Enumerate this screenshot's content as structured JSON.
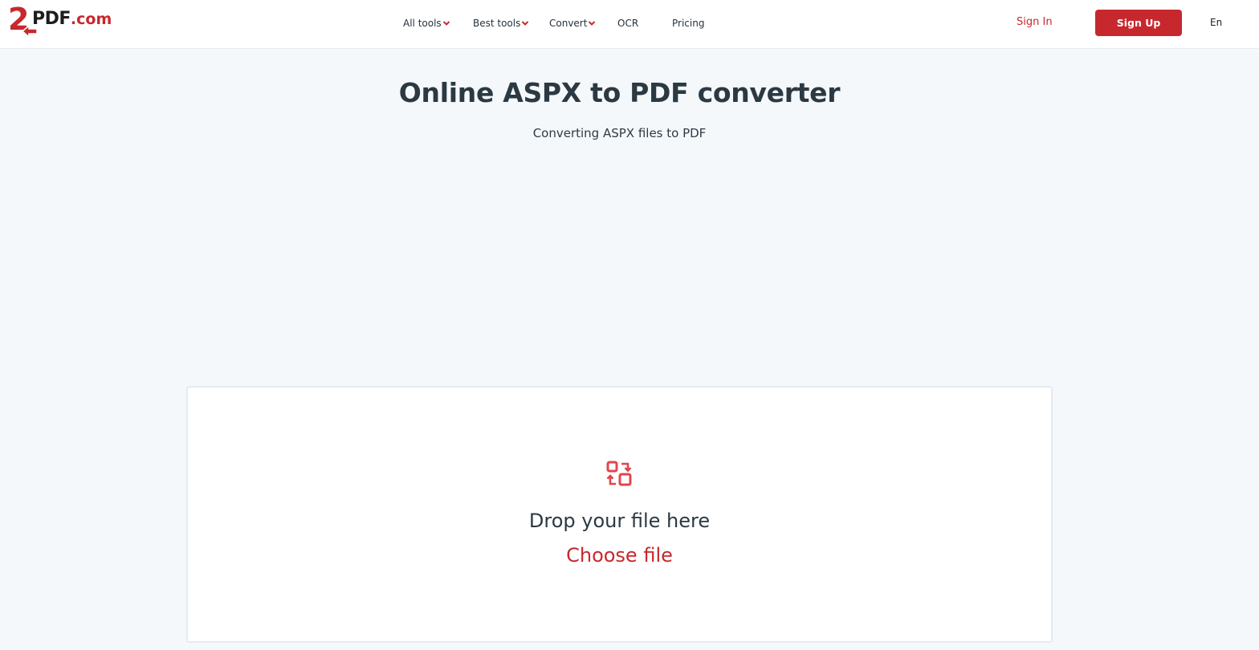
{
  "header": {
    "logo": {
      "two": "2",
      "brand": "PDF",
      "tld": ".com"
    },
    "nav": [
      {
        "label": "All tools",
        "has_dropdown": true
      },
      {
        "label": "Best tools",
        "has_dropdown": true
      },
      {
        "label": "Convert",
        "has_dropdown": true
      },
      {
        "label": "OCR",
        "has_dropdown": false
      },
      {
        "label": "Pricing",
        "has_dropdown": false
      }
    ],
    "sign_in": "Sign In",
    "sign_up": "Sign Up",
    "language": "En"
  },
  "main": {
    "title": "Online ASPX to PDF converter",
    "subtitle": "Converting ASPX files to PDF",
    "dropzone": {
      "icon": "convert-icon",
      "prompt": "Drop your file here",
      "choose": "Choose file"
    }
  },
  "colors": {
    "accent": "#c7282d",
    "page_background": "#f5f8fb",
    "text": "#2b3942"
  }
}
